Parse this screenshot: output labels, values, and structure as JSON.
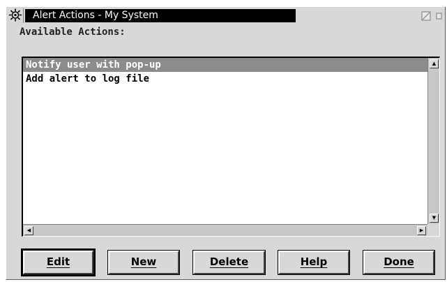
{
  "window": {
    "title": "Alert Actions - My System"
  },
  "titlebar": {
    "system_icon": "gear-icon",
    "maximize_icon": "maximize-icon",
    "minimize_icon": "minimize-icon"
  },
  "main": {
    "available_label": "Available Actions:",
    "actions": [
      {
        "label": "Notify user with pop-up",
        "selected": true
      },
      {
        "label": "Add alert to log file",
        "selected": false
      }
    ]
  },
  "buttons": {
    "edit": "Edit",
    "new": "New",
    "delete": "Delete",
    "help": "Help",
    "done": "Done"
  },
  "colors": {
    "window_bg": "#d8d8d8",
    "title_band": "#000000",
    "selection": "#8c8c8c"
  }
}
